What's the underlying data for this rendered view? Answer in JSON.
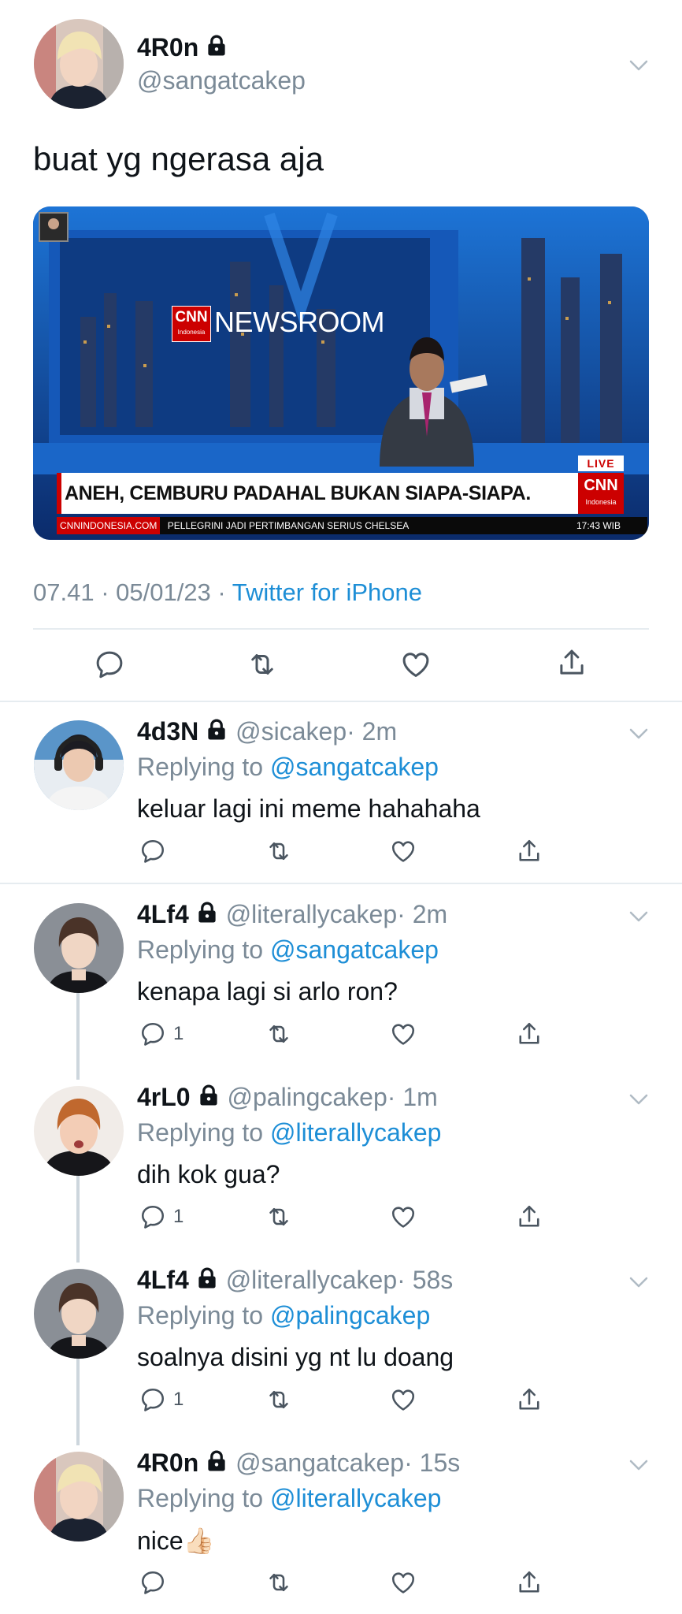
{
  "main_tweet": {
    "display_name": "4R0n",
    "handle": "@sangatcakep",
    "text": "buat yg ngerasa aja",
    "media": {
      "brand": "CNN",
      "brand_sub": "Indonesia",
      "program": "NEWSROOM",
      "live": "LIVE",
      "headline": "ANEH, CEMBURU PADAHAL BUKAN SIAPA-SIAPA.",
      "ticker_site": "CNNINDONESIA.COM",
      "ticker_text": "PELLEGRINI JADI PERTIMBANGAN SERIUS CHELSEA",
      "ticker_time": "17:43 WIB"
    },
    "time": "07.41 · 05/01/23 ·",
    "source": "Twitter for iPhone"
  },
  "replies": [
    {
      "name": "4d3N",
      "handle": "@sicakep",
      "time": "· 2m",
      "replying_label": "Replying to",
      "replying_to": "@sangatcakep",
      "text": "keluar lagi ini meme hahahaha",
      "reply_count": ""
    },
    {
      "name": "4Lf4",
      "handle": "@literallycakep",
      "time": "· 2m",
      "replying_label": "Replying to",
      "replying_to": "@sangatcakep",
      "text": "kenapa lagi si arlo ron?",
      "reply_count": "1"
    },
    {
      "name": "4rL0",
      "handle": "@palingcakep",
      "time": "· 1m",
      "replying_label": "Replying to",
      "replying_to": "@literallycakep",
      "text": "dih kok gua?",
      "reply_count": "1"
    },
    {
      "name": "4Lf4",
      "handle": "@literallycakep",
      "time": "· 58s",
      "replying_label": "Replying to",
      "replying_to": "@palingcakep",
      "text": "soalnya disini yg nt lu doang",
      "reply_count": "1"
    },
    {
      "name": "4R0n",
      "handle": "@sangatcakep",
      "time": "· 15s",
      "replying_label": "Replying to",
      "replying_to": "@literallycakep",
      "text": "nice👍🏻",
      "reply_count": ""
    }
  ],
  "icons": [
    "reply-icon",
    "retweet-icon",
    "like-icon",
    "share-icon",
    "chevron-down-icon",
    "lock-icon"
  ],
  "colors": {
    "link": "#1d8ed6",
    "muted": "#7b8a97",
    "text": "#0f1419",
    "divider": "#e6ecf0"
  }
}
